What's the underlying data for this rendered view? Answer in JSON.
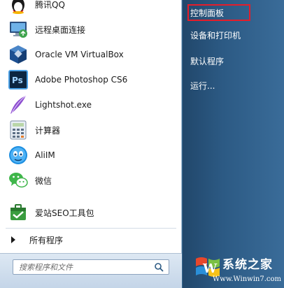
{
  "programs": [
    {
      "label": "腾讯QQ",
      "icon": "qq-penguin-icon"
    },
    {
      "label": "远程桌面连接",
      "icon": "remote-desktop-icon"
    },
    {
      "label": "Oracle VM VirtualBox",
      "icon": "virtualbox-icon"
    },
    {
      "label": "Adobe Photoshop CS6",
      "icon": "photoshop-icon"
    },
    {
      "label": "Lightshot.exe",
      "icon": "lightshot-feather-icon"
    },
    {
      "label": "计算器",
      "icon": "calculator-icon"
    },
    {
      "label": "AliIM",
      "icon": "aliim-icon"
    },
    {
      "label": "微信",
      "icon": "wechat-icon"
    },
    {
      "label": "爱站SEO工具包",
      "icon": "aizhan-seo-icon"
    }
  ],
  "all_programs": {
    "label": "所有程序"
  },
  "search": {
    "placeholder": "搜索程序和文件"
  },
  "right_menu": [
    {
      "label": "控制面板"
    },
    {
      "label": "设备和打印机"
    },
    {
      "label": "默认程序"
    },
    {
      "label": "运行..."
    }
  ],
  "logo": {
    "brand": "系统之家",
    "url": "Www.Winwin7.com",
    "letter": "W"
  },
  "colors": {
    "highlight": "#e51d2a",
    "right_pane": "#2c5a84"
  }
}
